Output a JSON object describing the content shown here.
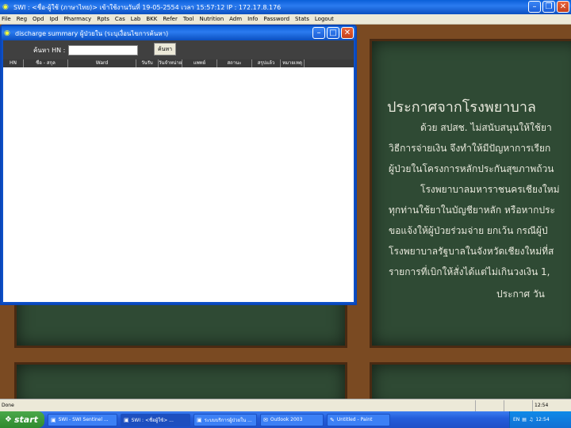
{
  "app": {
    "title": "SWI : <ชื่อ-ผู้ใช้ (ภาษาไทย)> เข้าใช้งานวันที่ 19-05-2554 เวลา 15:57:12 IP : 172.17.8.176",
    "icon": "app-logo-icon"
  },
  "menu": {
    "items": [
      "File",
      "Reg",
      "Opd",
      "Ipd",
      "Pharmacy",
      "Rpts",
      "Cas",
      "Lab",
      "BKK",
      "Refer",
      "Tool",
      "Nutrition",
      "Adm",
      "Info",
      "Password",
      "Stats",
      "Logout"
    ]
  },
  "child_window": {
    "title": "discharge summary ผู้ป่วยใน (ระบุเงื่อนไขการค้นหา)",
    "search_label": "ค้นหา HN :",
    "search_value": "",
    "search_button": "ค้นหา",
    "columns": [
      "HN",
      "ชื่อ - สกุล",
      "Ward",
      "วันรับ",
      "วันจำหน่าย",
      "แพทย์",
      "สถานะ",
      "สรุปแล้ว",
      "หมายเหตุ"
    ]
  },
  "board": {
    "title": "ประกาศจากโรงพยาบาล",
    "lines": [
      "ด้วย สปสช. ไม่สนับสนุนให้ใช้ยา",
      "วิธีการจ่ายเงิน จึงทำให้มีปัญหาการเรียก",
      "ผู้ป่วยในโครงการหลักประกันสุขภาพถ้วน",
      "โรงพยาบาลมหาราชนครเชียงใหม่",
      "ทุกท่านใช้ยาในบัญชียาหลัก หรือหากประ",
      "ขอแจ้งให้ผู้ป่วยร่วมจ่าย ยกเว้น กรณีผู้ป่",
      "โรงพยาบาลรัฐบาลในจังหวัดเชียงใหม่ที่ส",
      "รายการที่เบิกให้สั่งได้แต่ไม่เกินวงเงิน 1,",
      "ประกาศ วัน"
    ]
  },
  "statusbar": {
    "left": "Done",
    "right": "12:54"
  },
  "taskbar": {
    "start_label": "start",
    "tasks": [
      {
        "label": "SWI - SWI Sentinel ...",
        "icon": "window-icon",
        "active": false
      },
      {
        "label": "SWI : <ชื่อผู้ใช้> ...",
        "icon": "window-icon",
        "active": true
      },
      {
        "label": "ระบบบริการผู้ป่วยใน ...",
        "icon": "window-icon",
        "active": false
      },
      {
        "label": "Outlook 2003",
        "icon": "mail-icon",
        "active": false
      },
      {
        "label": "Untitled - Paint",
        "icon": "paint-icon",
        "active": false
      }
    ],
    "tray": {
      "lang": "EN",
      "clock": "12:54"
    }
  }
}
